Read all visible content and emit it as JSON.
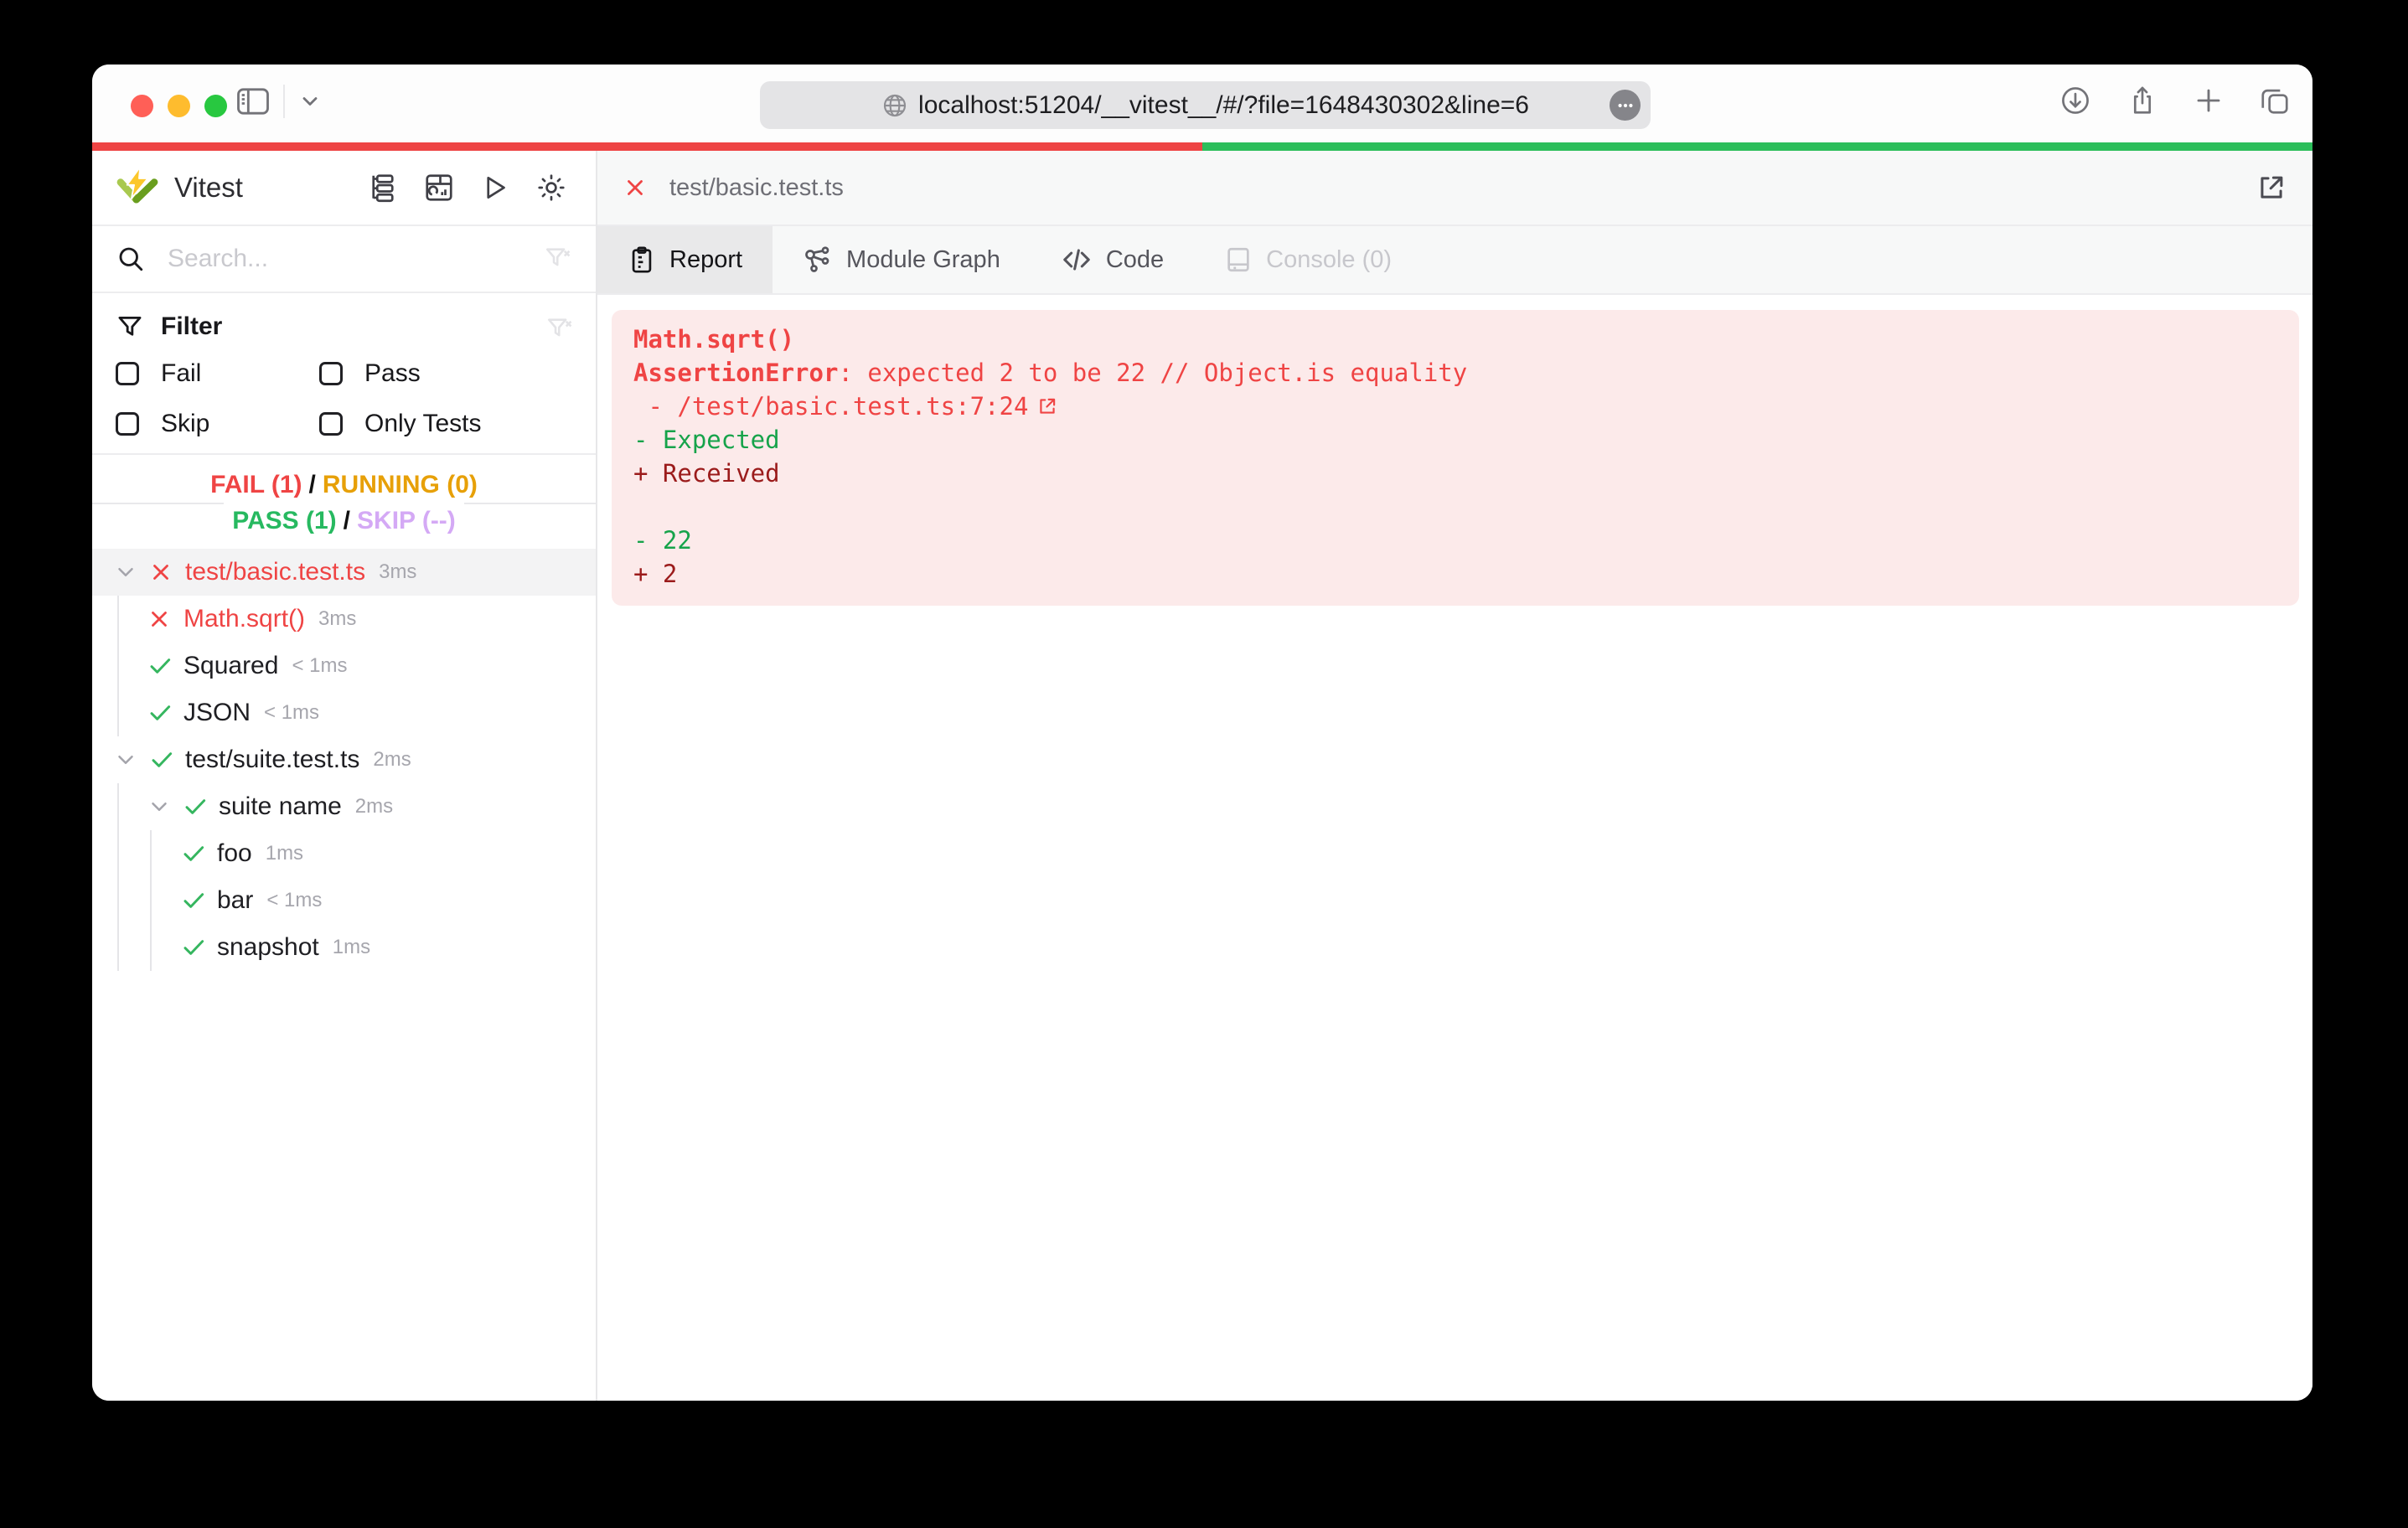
{
  "browser": {
    "url": "localhost:51204/__vitest__/#/?file=1648430302&line=6",
    "traffic_colors": {
      "close": "#ff5f57",
      "minimize": "#febc2e",
      "zoom": "#28c840"
    }
  },
  "progress": {
    "fail_pct": 50,
    "pass_pct": 50,
    "fail_color": "#ee4444",
    "pass_color": "#2cbe5b"
  },
  "sidebar": {
    "title": "Vitest",
    "search_placeholder": "Search...",
    "filter": {
      "title": "Filter",
      "options": [
        "Fail",
        "Pass",
        "Skip",
        "Only Tests"
      ]
    },
    "status": {
      "fail_label": "FAIL (1)",
      "running_label": "RUNNING (0)",
      "pass_label": "PASS (1)",
      "skip_label": "SKIP (--)",
      "separator": "/"
    },
    "tree": [
      {
        "label": "test/basic.test.ts",
        "duration": "3ms",
        "status": "fail",
        "depth": 0,
        "expandable": true,
        "selected": true
      },
      {
        "label": "Math.sqrt()",
        "duration": "3ms",
        "status": "fail",
        "depth": 1
      },
      {
        "label": "Squared",
        "duration": "< 1ms",
        "status": "pass",
        "depth": 1
      },
      {
        "label": "JSON",
        "duration": "< 1ms",
        "status": "pass",
        "depth": 1
      },
      {
        "label": "test/suite.test.ts",
        "duration": "2ms",
        "status": "pass",
        "depth": 0,
        "expandable": true
      },
      {
        "label": "suite name",
        "duration": "2ms",
        "status": "pass",
        "depth": 1,
        "expandable": true
      },
      {
        "label": "foo",
        "duration": "1ms",
        "status": "pass",
        "depth": 2
      },
      {
        "label": "bar",
        "duration": "< 1ms",
        "status": "pass",
        "depth": 2
      },
      {
        "label": "snapshot",
        "duration": "1ms",
        "status": "pass",
        "depth": 2
      }
    ]
  },
  "main": {
    "file_tab": "test/basic.test.ts",
    "tabs": [
      {
        "label": "Report",
        "icon": "clipboard-icon",
        "active": true
      },
      {
        "label": "Module Graph",
        "icon": "graph-icon"
      },
      {
        "label": "Code",
        "icon": "code-icon"
      },
      {
        "label": "Console (0)",
        "icon": "console-icon",
        "disabled": true
      }
    ],
    "report": {
      "test_name": "Math.sqrt()",
      "error_name": "AssertionError",
      "error_message": ": expected 2 to be 22 // Object.is equality",
      "stack": " - /test/basic.test.ts:7:24",
      "diff": [
        {
          "text": "- Expected",
          "type": "expected"
        },
        {
          "text": "+ Received",
          "type": "received"
        },
        {
          "text": "",
          "type": "blank"
        },
        {
          "text": "- 22",
          "type": "expected"
        },
        {
          "text": "+ 2",
          "type": "received"
        }
      ]
    }
  }
}
